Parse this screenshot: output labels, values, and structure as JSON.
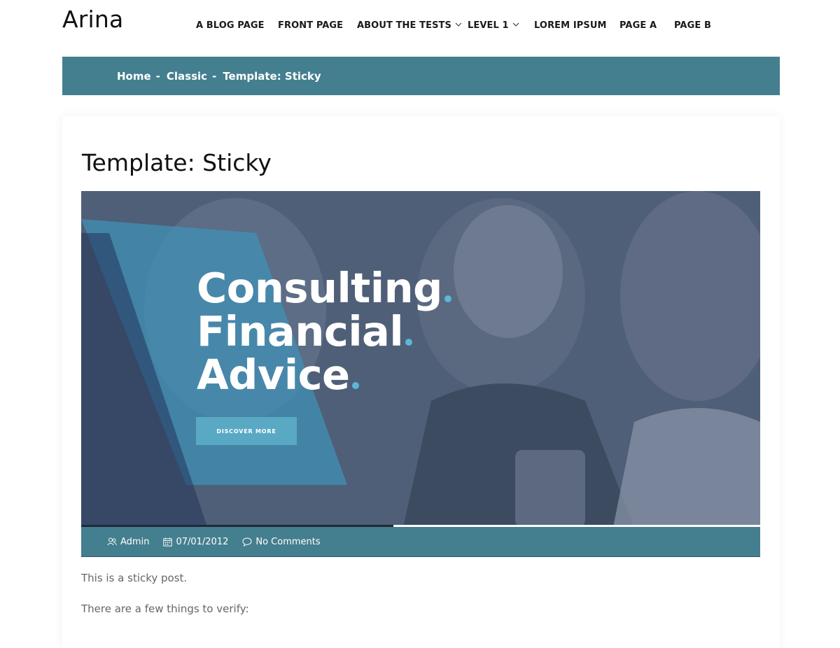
{
  "site": {
    "title": "Arina"
  },
  "nav": {
    "items": [
      {
        "label": "A BLOG PAGE",
        "dropdown": false
      },
      {
        "label": "FRONT PAGE",
        "dropdown": false
      },
      {
        "label": "ABOUT THE TESTS",
        "dropdown": true
      },
      {
        "label": "LEVEL 1",
        "dropdown": true
      },
      {
        "label": "LOREM IPSUM",
        "dropdown": false
      },
      {
        "label": "PAGE A",
        "dropdown": false
      },
      {
        "label": "PAGE B",
        "dropdown": false
      }
    ]
  },
  "breadcrumb": {
    "items": [
      "Home",
      "Classic",
      "Template: Sticky"
    ],
    "separator": "-"
  },
  "post": {
    "title": "Template: Sticky",
    "hero": {
      "lines": [
        "Consulting",
        "Financial",
        "Advice"
      ],
      "button_label": "DISCOVER MORE",
      "slider_progress": 0.46
    },
    "meta": {
      "author": "Admin",
      "date": "07/01/2012",
      "comments": "No Comments"
    },
    "paragraphs": [
      "This is a sticky post.",
      "There are a few things to verify:"
    ]
  },
  "colors": {
    "brand_teal": "#447f8f",
    "accent_dot": "#5bb8d6",
    "hero_button": "#5aa9c4",
    "hero_overlay_panel": "#3f93b9"
  },
  "icons": {
    "author": "user-icon",
    "date": "calendar-icon",
    "comments": "comment-icon",
    "dropdown": "chevron-down-icon"
  }
}
